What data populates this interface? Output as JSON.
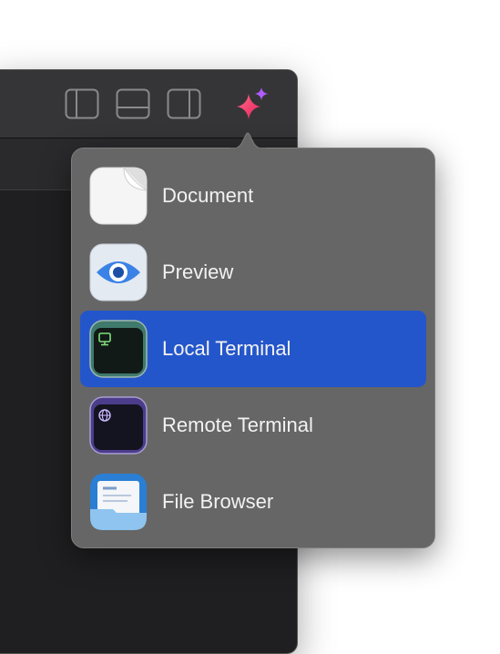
{
  "toolbar": {
    "buttons": [
      {
        "name": "toggle-left-sidebar",
        "icon": "sidebar-left-icon"
      },
      {
        "name": "toggle-bottom-panel",
        "icon": "panel-bottom-icon"
      },
      {
        "name": "toggle-right-sidebar",
        "icon": "sidebar-right-icon"
      }
    ],
    "new_item_icon": "sparkle-plus-icon"
  },
  "new_menu": {
    "selected_index": 2,
    "items": [
      {
        "label": "Document",
        "icon": "document-icon"
      },
      {
        "label": "Preview",
        "icon": "eye-icon"
      },
      {
        "label": "Local Terminal",
        "icon": "local-terminal-icon"
      },
      {
        "label": "Remote Terminal",
        "icon": "remote-terminal-icon"
      },
      {
        "label": "File Browser",
        "icon": "folder-icon"
      }
    ]
  },
  "colors": {
    "selection": "#2456cb",
    "popover_bg": "#666666",
    "titlebar": "#353537",
    "sparkle_pink": "#ff3d6e",
    "sparkle_purple": "#b15cff"
  }
}
